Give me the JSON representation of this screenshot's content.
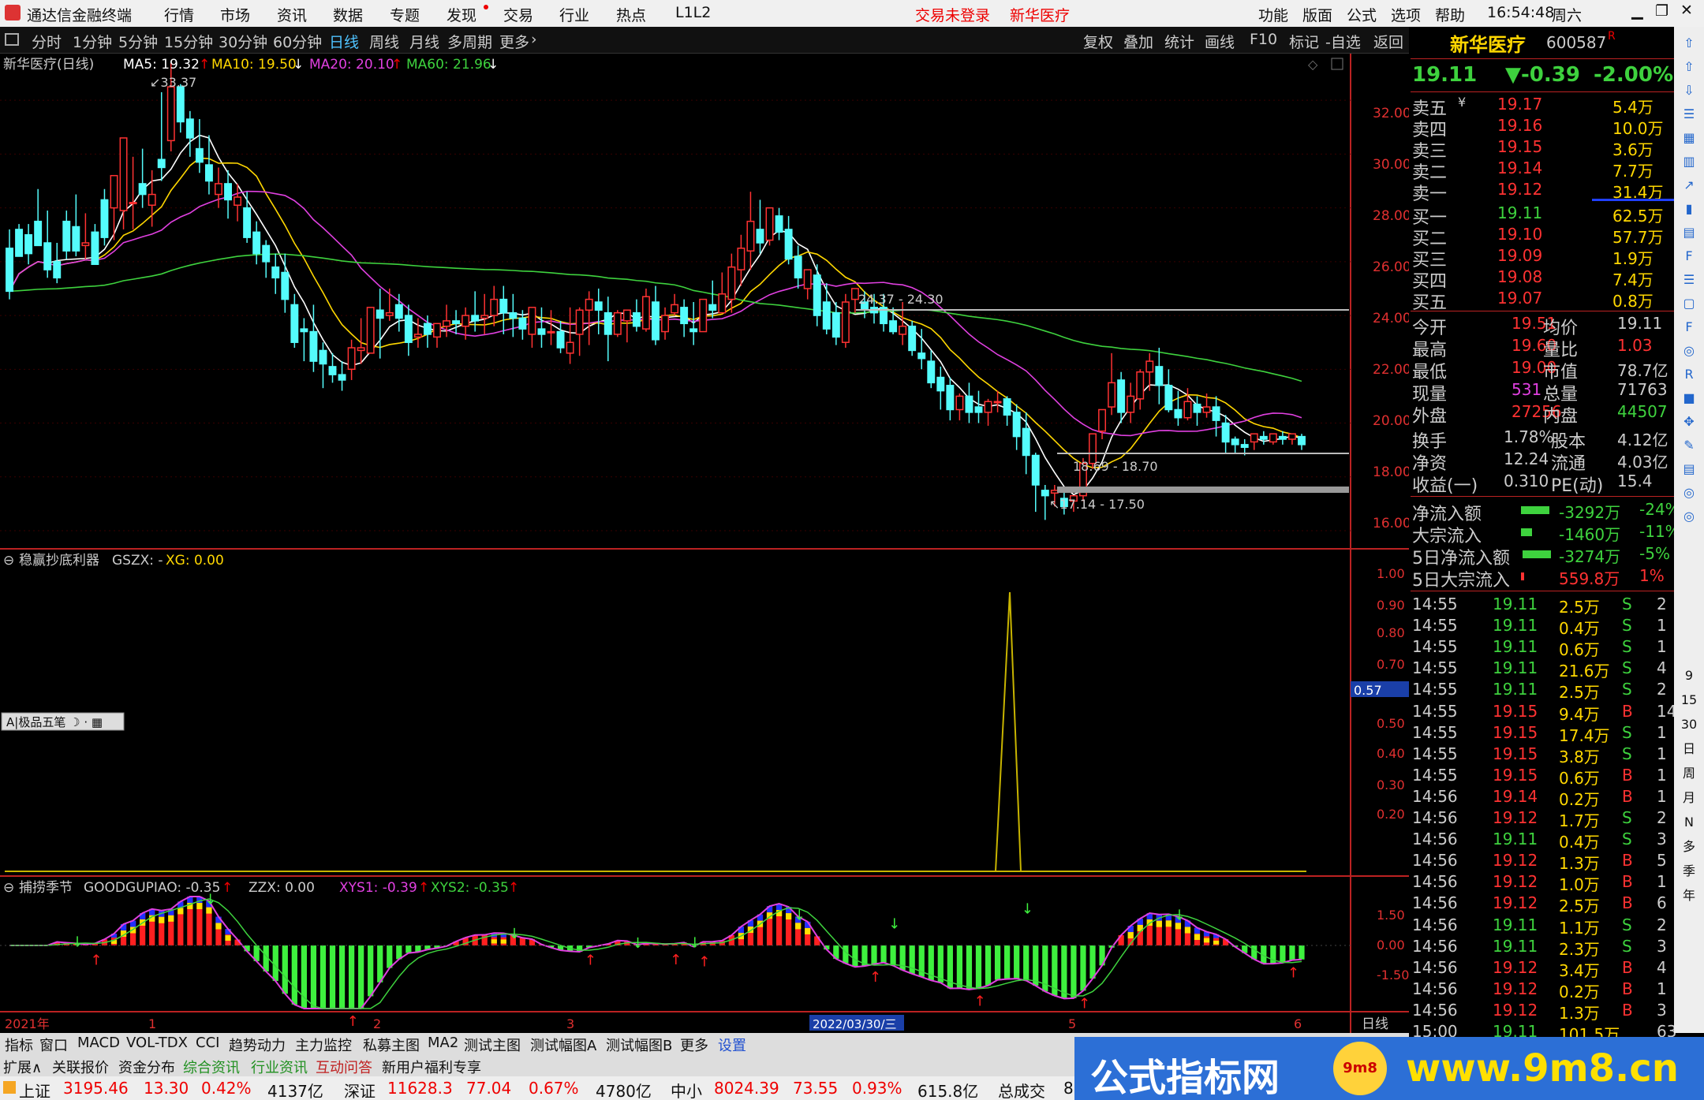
{
  "app": {
    "title": "通达信金融终端",
    "menus": [
      "行情",
      "市场",
      "资讯",
      "数据",
      "专题",
      "发现",
      "交易",
      "行业",
      "热点",
      "L1L2"
    ],
    "login_status": "交易未登录",
    "stock_label": "新华医疗",
    "right_menus": [
      "功能",
      "版面",
      "公式",
      "选项",
      "帮助"
    ],
    "clock": "16:54:48",
    "weekday": "周六"
  },
  "periods": [
    "分时",
    "1分钟",
    "5分钟",
    "15分钟",
    "30分钟",
    "60分钟",
    "日线",
    "周线",
    "月线",
    "多周期",
    "更多"
  ],
  "active_period": "日线",
  "toolbar_right": [
    "复权",
    "叠加",
    "统计",
    "画线",
    "F10",
    "标记",
    "-自选",
    "返回"
  ],
  "main_legend": {
    "name": "新华医疗(日线)",
    "ma5": "MA5: 19.32",
    "ma10": "MA10: 19.50",
    "ma20": "MA20: 20.10",
    "ma60": "MA60: 21.96",
    "ma5_arrow": "↑",
    "ma10_arrow": "↓",
    "ma20_arrow": "↑",
    "ma60_arrow": "↓"
  },
  "price_axis": [
    "32.00",
    "30.00",
    "28.00",
    "26.00",
    "24.00",
    "22.00",
    "20.00",
    "18.00",
    "16.00"
  ],
  "annotations": {
    "high": "33.37",
    "range1": "24.37 - 24.30",
    "range2": "18.69 - 18.70",
    "range3": "17.14 - 17.50"
  },
  "ind1": {
    "legend": "稳赢抄底利器",
    "code": "GSZX: -",
    "xg": "XG: 0.00",
    "axis": [
      "1.00",
      "0.90",
      "0.80",
      "0.70",
      "0.57",
      "0.50",
      "0.40",
      "0.30",
      "0.20"
    ],
    "tool": "极品五笔"
  },
  "ind2": {
    "legend": "捕捞季节",
    "gg": "GOODGUPIAO: -0.35",
    "zzx": "ZZX: 0.00",
    "xys1": "XYS1: -0.39",
    "xys2": "XYS2: -0.35",
    "axis": [
      "1.50",
      "0.00",
      "-1.50"
    ]
  },
  "date_axis": {
    "labels": [
      "2021年",
      "1",
      "2",
      "3",
      "2022/03/30/三",
      "5",
      "6"
    ],
    "period": "日线"
  },
  "bottom_tabs": [
    "指标",
    "窗口",
    "MACD",
    "VOL-TDX",
    "CCI",
    "趋势动力",
    "主力监控",
    "私募主图",
    "MA2",
    "测试主图",
    "测试幅图A",
    "测试幅图B",
    "更多",
    "设置"
  ],
  "bottom_tabs2": [
    "扩展∧",
    "关联报价",
    "资金分布",
    "综合资讯",
    "行业资讯",
    "互动问答",
    "新用户福利专享"
  ],
  "quote": {
    "name": "新华医疗",
    "code": "600587",
    "flag": "R",
    "price": "19.11",
    "change": "▼-0.39",
    "pct": "-2.00%",
    "sell": [
      {
        "label": "卖五",
        "sym": "¥",
        "price": "19.17",
        "vol": "5.4万"
      },
      {
        "label": "卖四",
        "price": "19.16",
        "vol": "10.0万"
      },
      {
        "label": "卖三",
        "price": "19.15",
        "vol": "3.6万"
      },
      {
        "label": "卖二",
        "price": "19.14",
        "vol": "7.7万"
      },
      {
        "label": "卖一",
        "price": "19.12",
        "vol": "31.4万"
      }
    ],
    "buy": [
      {
        "label": "买一",
        "price": "19.11",
        "vol": "62.5万"
      },
      {
        "label": "买二",
        "price": "19.10",
        "vol": "57.7万"
      },
      {
        "label": "买三",
        "price": "19.09",
        "vol": "1.9万"
      },
      {
        "label": "买四",
        "price": "19.08",
        "vol": "7.4万"
      },
      {
        "label": "买五",
        "price": "19.07",
        "vol": "0.8万"
      }
    ],
    "stats": [
      [
        "今开",
        "19.51",
        "均价",
        "19.11"
      ],
      [
        "最高",
        "19.60",
        "量比",
        "1.03"
      ],
      [
        "最低",
        "19.00",
        "市值",
        "78.7亿"
      ],
      [
        "现量",
        "531",
        "总量",
        "71763"
      ],
      [
        "外盘",
        "27256",
        "内盘",
        "44507"
      ]
    ],
    "stats2": [
      [
        "换手",
        "1.78%",
        "股本",
        "4.12亿"
      ],
      [
        "净资",
        "12.24",
        "流通",
        "4.03亿"
      ],
      [
        "收益(一)",
        "0.310",
        "PE(动)",
        "15.4"
      ]
    ],
    "flows": [
      [
        "净流入额",
        "-3292万",
        "-24%"
      ],
      [
        "大宗流入",
        "-1460万",
        "-11%"
      ],
      [
        "5日净流入额",
        "-3274万",
        "-5%"
      ],
      [
        "5日大宗流入",
        "559.8万",
        "1%"
      ]
    ],
    "ticks": [
      [
        "14:55",
        "19.11",
        "2.5万",
        "S",
        "2"
      ],
      [
        "14:55",
        "19.11",
        "0.4万",
        "S",
        "1"
      ],
      [
        "14:55",
        "19.11",
        "0.6万",
        "S",
        "1"
      ],
      [
        "14:55",
        "19.11",
        "21.6万",
        "S",
        "4"
      ],
      [
        "14:55",
        "19.11",
        "2.5万",
        "S",
        "2"
      ],
      [
        "14:55",
        "19.15",
        "9.4万",
        "B",
        "14"
      ],
      [
        "14:55",
        "19.15",
        "17.4万",
        "S",
        "1"
      ],
      [
        "14:55",
        "19.15",
        "3.8万",
        "S",
        "1"
      ],
      [
        "14:55",
        "19.15",
        "0.6万",
        "B",
        "1"
      ],
      [
        "14:56",
        "19.14",
        "0.2万",
        "B",
        "1"
      ],
      [
        "14:56",
        "19.12",
        "1.7万",
        "S",
        "2"
      ],
      [
        "14:56",
        "19.11",
        "0.4万",
        "S",
        "3"
      ],
      [
        "14:56",
        "19.12",
        "1.3万",
        "B",
        "5"
      ],
      [
        "14:56",
        "19.12",
        "1.0万",
        "B",
        "1"
      ],
      [
        "14:56",
        "19.12",
        "2.5万",
        "B",
        "6"
      ],
      [
        "14:56",
        "19.11",
        "1.1万",
        "S",
        "2"
      ],
      [
        "14:56",
        "19.11",
        "2.3万",
        "S",
        "3"
      ],
      [
        "14:56",
        "19.12",
        "3.4万",
        "B",
        "4"
      ],
      [
        "14:56",
        "19.12",
        "0.2万",
        "B",
        "1"
      ],
      [
        "14:56",
        "19.12",
        "1.3万",
        "B",
        "3"
      ],
      [
        "15:00",
        "19.11",
        "101.5万",
        "",
        "63"
      ]
    ]
  },
  "side_icons": [
    "up-icon",
    "up-icon",
    "down-icon",
    "list-icon",
    "grid-icon",
    "bars-icon",
    "line-icon",
    "candle-icon",
    "table-icon",
    "f-icon",
    "list-icon",
    "doc-icon",
    "f-icon",
    "ring-icon",
    "rsi-icon",
    "red-icon",
    "nav-icon",
    "pen-icon",
    "table-icon",
    "ring-icon",
    "ring-icon"
  ],
  "side_labels": [
    "9",
    "15",
    "30",
    "日",
    "周",
    "月",
    "N",
    "多",
    "季",
    "年"
  ],
  "status": {
    "sh_label": "上证",
    "sh": "3195.46",
    "sh_ch": "13.30",
    "sh_pct": "0.42%",
    "sh_amt": "4137亿",
    "sz_label": "深证",
    "sz": "11628.3",
    "sz_ch": "77.04",
    "sz_pct": "0.67%",
    "sz_amt": "4780亿",
    "zx_label": "中小",
    "zx": "8024.39",
    "zx_ch": "73.55",
    "zx_pct": "0.93%",
    "zx_amt": "615.8亿",
    "total_label": "总成交",
    "total": "8"
  },
  "watermark": {
    "title": "公式指标网",
    "url": "www.9m8.cn",
    "logo": "9m8"
  },
  "chart_data": {
    "type": "candlestick",
    "ylim": [
      16,
      33.5
    ],
    "candles": [
      [
        26.5,
        27.2,
        24.9,
        24.6
      ],
      [
        27.2,
        27.4,
        26.2,
        26.4
      ],
      [
        27.0,
        27.4,
        26.3,
        25.9
      ],
      [
        27.5,
        28.7,
        26.6,
        26.6
      ],
      [
        26.7,
        27.9,
        25.7,
        25.4
      ],
      [
        26.0,
        26.7,
        25.4,
        25.2
      ],
      [
        27.5,
        27.9,
        26.4,
        26.1
      ],
      [
        27.3,
        28.5,
        26.4,
        26.2
      ],
      [
        26.6,
        27.8,
        26.7,
        26.1
      ],
      [
        27.1,
        27.4,
        25.9,
        26.5
      ],
      [
        28.3,
        28.7,
        26.9,
        26.6
      ],
      [
        28.0,
        28.9,
        29.2,
        26.8
      ],
      [
        27.9,
        28.6,
        30.6,
        27.2
      ],
      [
        28.2,
        29.9,
        28.2,
        27.2
      ],
      [
        28.9,
        30.2,
        28.5,
        28.0
      ],
      [
        28.1,
        29.4,
        28.5,
        27.3
      ],
      [
        29.8,
        32.3,
        29.5,
        29.0
      ],
      [
        30.5,
        33.4,
        32.5,
        30.1
      ],
      [
        32.5,
        32.6,
        31.2,
        30.8
      ],
      [
        31.3,
        31.6,
        30.6,
        29.9
      ],
      [
        30.2,
        31.3,
        29.7,
        29.3
      ],
      [
        29.6,
        30.7,
        29.0,
        28.5
      ],
      [
        28.5,
        29.5,
        28.9,
        28.0
      ],
      [
        28.9,
        29.4,
        28.3,
        27.6
      ],
      [
        28.1,
        28.9,
        28.4,
        27.5
      ],
      [
        28.0,
        28.6,
        26.9,
        26.7
      ],
      [
        27.1,
        27.5,
        26.3,
        25.9
      ],
      [
        26.6,
        26.8,
        26.0,
        25.4
      ],
      [
        25.8,
        26.3,
        25.4,
        24.8
      ],
      [
        25.6,
        26.3,
        24.6,
        24.1
      ],
      [
        24.4,
        24.8,
        23.0,
        22.8
      ],
      [
        23.5,
        23.9,
        23.4,
        22.3
      ],
      [
        23.4,
        24.4,
        22.3,
        21.9
      ],
      [
        22.7,
        23.0,
        22.2,
        21.3
      ],
      [
        22.1,
        22.6,
        21.8,
        21.5
      ],
      [
        21.8,
        22.3,
        21.6,
        21.2
      ],
      [
        22.0,
        23.1,
        22.8,
        21.6
      ],
      [
        22.7,
        23.9,
        22.8,
        22.2
      ],
      [
        22.6,
        23.8,
        24.3,
        22.6
      ],
      [
        24.2,
        25.0,
        23.9,
        22.4
      ],
      [
        24.0,
        25.0,
        24.1,
        23.8
      ],
      [
        24.4,
        24.8,
        23.9,
        23.4
      ],
      [
        24.0,
        24.4,
        23.0,
        22.5
      ],
      [
        23.2,
        23.9,
        23.3,
        22.8
      ],
      [
        23.7,
        24.0,
        23.3,
        22.8
      ],
      [
        23.2,
        23.7,
        23.7,
        22.8
      ],
      [
        23.6,
        24.4,
        23.8,
        23.2
      ],
      [
        23.8,
        24.2,
        23.7,
        23.3
      ],
      [
        23.6,
        24.3,
        24.0,
        23.1
      ],
      [
        24.0,
        24.9,
        23.8,
        23.4
      ],
      [
        23.9,
        24.8,
        24.0,
        23.3
      ],
      [
        24.0,
        25.1,
        24.6,
        23.6
      ],
      [
        24.6,
        25.1,
        24.1,
        23.3
      ],
      [
        24.1,
        24.8,
        23.9,
        23.2
      ],
      [
        23.9,
        24.2,
        23.5,
        23.1
      ],
      [
        23.3,
        23.7,
        24.3,
        22.8
      ],
      [
        23.5,
        24.3,
        23.3,
        22.8
      ],
      [
        23.4,
        24.2,
        23.4,
        22.9
      ],
      [
        23.4,
        23.8,
        22.8,
        22.6
      ],
      [
        22.6,
        24.3,
        23.0,
        22.2
      ],
      [
        23.3,
        24.3,
        24.2,
        22.5
      ],
      [
        24.2,
        24.9,
        24.6,
        22.9
      ],
      [
        24.5,
        25.0,
        24.2,
        23.3
      ],
      [
        24.1,
        24.7,
        23.3,
        22.3
      ],
      [
        23.3,
        24.2,
        24.1,
        23.2
      ],
      [
        23.8,
        24.2,
        24.2,
        23.0
      ],
      [
        24.1,
        24.6,
        23.6,
        23.4
      ],
      [
        23.5,
        25.0,
        24.7,
        23.4
      ],
      [
        24.5,
        25.1,
        23.1,
        22.9
      ],
      [
        23.4,
        24.3,
        24.0,
        23.1
      ],
      [
        24.1,
        24.8,
        24.4,
        24.0
      ],
      [
        24.3,
        24.6,
        23.7,
        23.2
      ],
      [
        23.5,
        24.5,
        23.4,
        22.9
      ],
      [
        23.4,
        24.0,
        24.6,
        23.4
      ],
      [
        24.4,
        25.3,
        24.2,
        23.9
      ],
      [
        24.1,
        25.6,
        24.8,
        24.1
      ],
      [
        24.6,
        26.3,
        25.8,
        24.1
      ],
      [
        25.7,
        27.0,
        26.5,
        25.1
      ],
      [
        26.4,
        28.6,
        27.5,
        25.7
      ],
      [
        27.2,
        28.3,
        26.7,
        26.3
      ],
      [
        26.8,
        28.0,
        28.0,
        26.6
      ],
      [
        27.7,
        28.0,
        27.1,
        26.8
      ],
      [
        27.2,
        27.7,
        26.1,
        25.9
      ],
      [
        26.2,
        26.6,
        25.4,
        25.0
      ],
      [
        25.0,
        25.3,
        25.7,
        24.6
      ],
      [
        25.5,
        25.9,
        24.0,
        23.6
      ],
      [
        24.5,
        25.2,
        23.5,
        23.3
      ],
      [
        24.1,
        24.5,
        23.2,
        22.9
      ],
      [
        23.0,
        24.8,
        24.5,
        22.8
      ],
      [
        24.6,
        25.0,
        25.0,
        24.1
      ],
      [
        24.5,
        24.9,
        24.2,
        23.9
      ],
      [
        24.3,
        24.8,
        24.1,
        23.7
      ],
      [
        24.3,
        24.8,
        23.7,
        23.4
      ],
      [
        23.8,
        24.3,
        23.4,
        23.3
      ],
      [
        23.3,
        24.5,
        23.6,
        22.9
      ],
      [
        23.6,
        23.8,
        22.7,
        22.5
      ],
      [
        22.6,
        23.5,
        22.4,
        22.0
      ],
      [
        22.3,
        22.7,
        21.5,
        21.3
      ],
      [
        21.7,
        22.1,
        21.2,
        20.5
      ],
      [
        21.4,
        21.7,
        20.5,
        20.1
      ],
      [
        20.5,
        21.1,
        21.0,
        20.1
      ],
      [
        21.0,
        21.5,
        20.4,
        20.0
      ],
      [
        20.6,
        21.2,
        20.4,
        20.0
      ],
      [
        20.4,
        20.9,
        20.8,
        19.9
      ],
      [
        20.8,
        21.2,
        20.8,
        20.4
      ],
      [
        20.9,
        21.0,
        20.3,
        19.9
      ],
      [
        20.4,
        20.7,
        19.5,
        19.0
      ],
      [
        19.8,
        20.4,
        18.8,
        18.1
      ],
      [
        18.8,
        18.9,
        17.7,
        16.7
      ],
      [
        17.5,
        17.7,
        17.3,
        16.4
      ],
      [
        17.4,
        17.7,
        17.5,
        16.9
      ],
      [
        17.2,
        17.5,
        16.9,
        16.6
      ],
      [
        17.1,
        17.2,
        17.3,
        16.7
      ],
      [
        17.3,
        18.7,
        18.5,
        17.1
      ],
      [
        18.5,
        19.6,
        19.6,
        18.3
      ],
      [
        19.7,
        20.5,
        20.5,
        19.4
      ],
      [
        20.6,
        22.6,
        21.5,
        20.3
      ],
      [
        21.6,
        21.9,
        20.4,
        20.0
      ],
      [
        20.4,
        21.5,
        21.0,
        20.0
      ],
      [
        20.9,
        22.0,
        21.9,
        20.5
      ],
      [
        21.9,
        22.6,
        22.3,
        21.2
      ],
      [
        22.1,
        22.8,
        21.4,
        20.7
      ],
      [
        21.4,
        22.0,
        20.5,
        20.4
      ],
      [
        20.5,
        21.2,
        20.2,
        19.9
      ],
      [
        20.2,
        21.3,
        20.8,
        20.1
      ],
      [
        20.7,
        21.0,
        20.4,
        19.9
      ],
      [
        20.4,
        21.1,
        20.6,
        20.2
      ],
      [
        20.6,
        21.0,
        20.1,
        19.5
      ],
      [
        20.0,
        20.3,
        19.3,
        18.9
      ],
      [
        19.4,
        19.5,
        19.2,
        18.9
      ],
      [
        19.2,
        19.4,
        19.1,
        18.8
      ],
      [
        19.3,
        19.5,
        19.6,
        19.0
      ],
      [
        19.5,
        19.7,
        19.4,
        19.2
      ],
      [
        19.3,
        19.5,
        19.6,
        19.2
      ],
      [
        19.5,
        19.7,
        19.4,
        19.2
      ],
      [
        19.4,
        19.6,
        19.6,
        19.2
      ],
      [
        19.5,
        19.6,
        19.2,
        19.0
      ]
    ]
  }
}
